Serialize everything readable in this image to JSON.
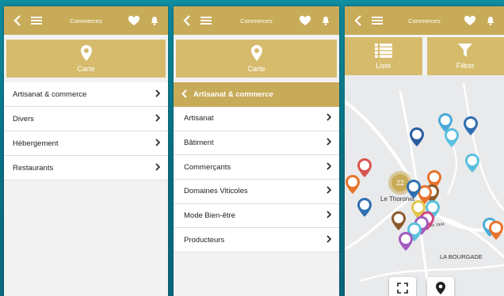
{
  "colors": {
    "gold": "#c8ab58",
    "gold_light": "#d6bb6c",
    "teal_bg": "#0b7a8f"
  },
  "screen1": {
    "header_title": "Commerces",
    "map_button_label": "Carte",
    "categories": [
      {
        "label": "Artisanat & commerce"
      },
      {
        "label": "Divers"
      },
      {
        "label": "Hébergement"
      },
      {
        "label": "Restaurants"
      }
    ]
  },
  "screen2": {
    "header_title": "Commerces",
    "map_button_label": "Carte",
    "subheader": "Artisanat & commerce",
    "subcategories": [
      {
        "label": "Artisanat"
      },
      {
        "label": "Bâtiment"
      },
      {
        "label": "Commerçants"
      },
      {
        "label": "Domaines Viticoles"
      },
      {
        "label": "Mode Bien-être"
      },
      {
        "label": "Producteurs"
      }
    ]
  },
  "screen3": {
    "header_title": "Commerces",
    "list_button_label": "Liste",
    "filter_button_label": "Filtrer",
    "map": {
      "cluster_count": "22",
      "place_label_1": "Le Thoronet",
      "place_label_2": "LA BOURGADE",
      "road_label": "Route 1944"
    }
  },
  "icons": {
    "back": "chevron-left-icon",
    "menu": "hamburger-menu-icon",
    "favorite": "heart-icon",
    "notifications": "bell-icon",
    "map_pin": "map-pin-icon",
    "list": "list-icon",
    "filter": "funnel-icon",
    "expand": "expand-arrows-icon",
    "locate": "location-pin-icon"
  }
}
